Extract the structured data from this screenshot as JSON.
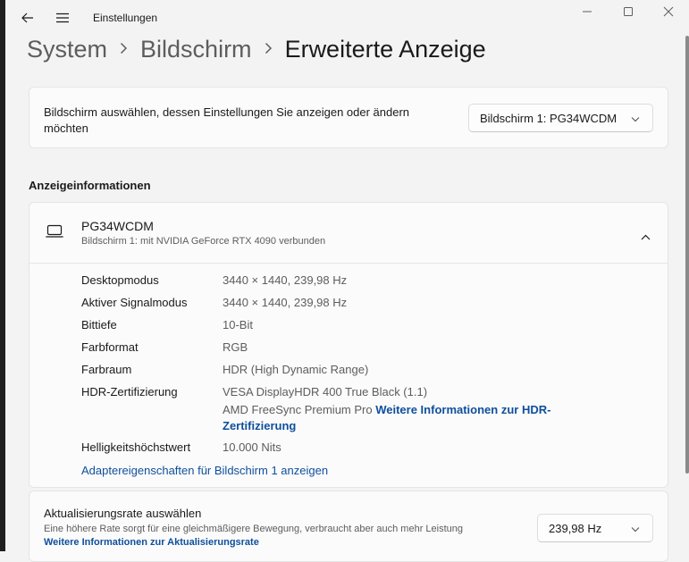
{
  "window": {
    "title": "Einstellungen"
  },
  "breadcrumb": {
    "items": [
      "System",
      "Bildschirm"
    ],
    "current": "Erweiterte Anzeige"
  },
  "display_select": {
    "label_line1": "Bildschirm auswählen, dessen Einstellungen Sie anzeigen oder ändern",
    "label_line2": "möchten",
    "value": "Bildschirm 1: PG34WCDM"
  },
  "display_info": {
    "section_title": "Anzeigeinformationen",
    "monitor_name": "PG34WCDM",
    "monitor_subtitle": "Bildschirm 1: mit NVIDIA GeForce RTX 4090 verbunden",
    "rows": [
      {
        "label": "Desktopmodus",
        "value": "3440 × 1440, 239,98 Hz"
      },
      {
        "label": "Aktiver Signalmodus",
        "value": "3440 × 1440, 239,98 Hz"
      },
      {
        "label": "Bittiefe",
        "value": "10-Bit"
      },
      {
        "label": "Farbformat",
        "value": "RGB"
      },
      {
        "label": "Farbraum",
        "value": "HDR (High Dynamic Range)"
      },
      {
        "label": "HDR-Zertifizierung",
        "value": "VESA DisplayHDR 400 True Black (1.1)"
      },
      {
        "label": "Helligkeitshöchstwert",
        "value": "10.000 Nits"
      }
    ],
    "hdr_line2_prefix": "AMD FreeSync Premium Pro",
    "hdr_link_part1": "Weitere Informationen zur HDR-",
    "hdr_link_part2": "Zertifizierung",
    "adapter_link": "Adaptereigenschaften für Bildschirm 1 anzeigen"
  },
  "refresh_rate": {
    "title": "Aktualisierungsrate auswählen",
    "description": "Eine höhere Rate sorgt für eine gleichmäßigere Bewegung, verbraucht aber auch mehr Leistung",
    "link": "Weitere Informationen zur Aktualisierungsrate",
    "value": "239,98 Hz"
  },
  "icons": {
    "back": "back-arrow-icon",
    "menu": "hamburger-menu-icon",
    "minimize": "minimize-icon",
    "maximize": "maximize-icon",
    "close": "close-icon",
    "monitor": "laptop-monitor-icon",
    "collapse": "chevron-up-icon",
    "dropdown": "chevron-down-icon"
  },
  "colors": {
    "background": "#f3f3f3",
    "card": "#fbfbfb",
    "link": "#0e4f9c"
  }
}
